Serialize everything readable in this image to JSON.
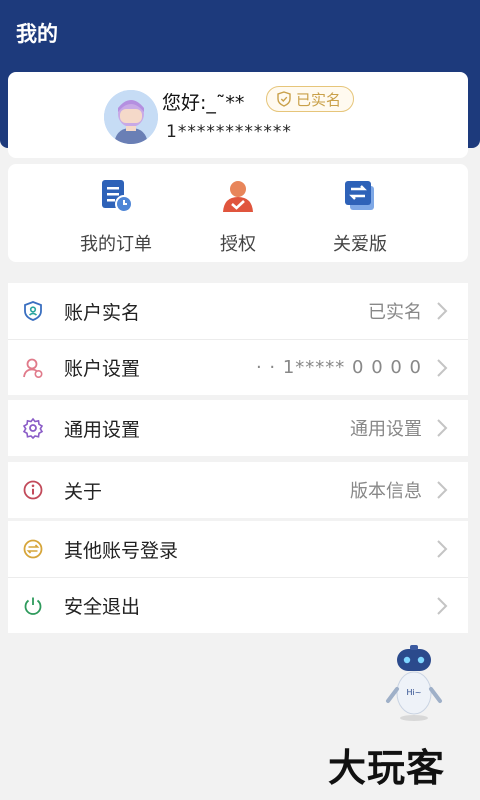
{
  "header": {
    "title": "我的"
  },
  "profile": {
    "greeting": "您好:_˜**",
    "verified_badge": "已实名",
    "phone": "1************"
  },
  "quick_actions": [
    {
      "label": "我的订单",
      "icon": "order-list-icon"
    },
    {
      "label": "授权",
      "icon": "authorize-person-icon"
    },
    {
      "label": "关爱版",
      "icon": "care-mode-switch-icon"
    }
  ],
  "menu": {
    "real_name": {
      "label": "账户实名",
      "value": "已实名",
      "icon": "shield-id-icon"
    },
    "account_settings": {
      "label": "账户设置",
      "value": "· · 1***** 0 0 0 0",
      "icon": "user-settings-icon"
    },
    "general_settings": {
      "label": "通用设置",
      "value": "通用设置",
      "icon": "gear-icon"
    },
    "about": {
      "label": "关于",
      "value": "版本信息",
      "icon": "info-icon"
    },
    "other_login": {
      "label": "其他账号登录",
      "value": "",
      "icon": "switch-account-icon"
    },
    "logout": {
      "label": "安全退出",
      "value": "",
      "icon": "power-icon"
    }
  },
  "assistant": {
    "badge": "Hi~"
  },
  "watermark": "大玩客",
  "colors": {
    "header_bg": "#1d3a7c",
    "badge_gold": "#c9a049",
    "page_bg": "#f2f2f2"
  }
}
